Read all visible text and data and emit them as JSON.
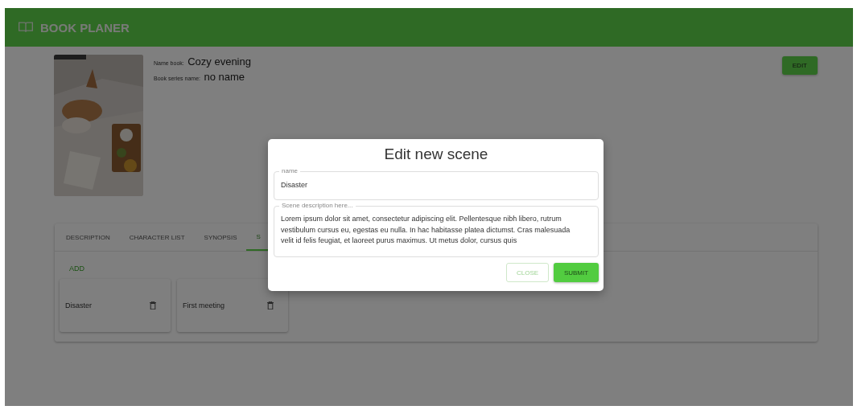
{
  "app_bar": {
    "title": "BOOK PLANER"
  },
  "book": {
    "name_label": "Name book:",
    "name": "Cozy evening",
    "series_label": "Book series name:",
    "series": "no name"
  },
  "edit_button": "EDIT",
  "tabs": [
    {
      "label": "DESCRIPTION",
      "selected": false
    },
    {
      "label": "CHARACTER LIST",
      "selected": false
    },
    {
      "label": "SYNOPSIS",
      "selected": false
    },
    {
      "label": "S",
      "selected": true
    }
  ],
  "add_button": "ADD",
  "scenes": [
    {
      "name": "Disaster"
    },
    {
      "name": "First meeting"
    }
  ],
  "dialog": {
    "title": "Edit new scene",
    "name_field": {
      "label": "name",
      "value": "Disaster"
    },
    "description_field": {
      "label": "Scene description here...",
      "value": "Lorem ipsum dolor sit amet, consectetur adipiscing elit. Pellentesque nibh libero, rutrum vestibulum cursus eu, egestas eu nulla. In hac habitasse platea dictumst. Cras malesuada velit id felis feugiat, et laoreet purus maximus. Ut metus dolor, cursus quis"
    },
    "buttons": [
      {
        "label": "CLOSE",
        "kind": "outlined"
      },
      {
        "label": "SUBMIT",
        "kind": "filled"
      }
    ]
  }
}
